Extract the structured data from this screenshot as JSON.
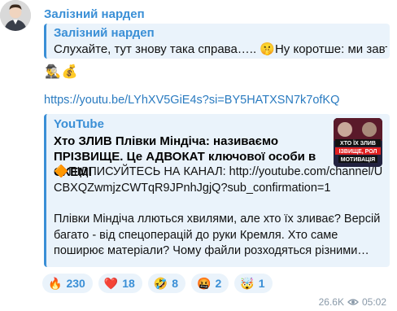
{
  "sender": "Залізний нардеп",
  "reply": {
    "sender": "Залізний нардеп",
    "text": "Слухайте, тут знову така справа….. 🤫Ну коротше: ми завтр…"
  },
  "emoji_line": "🕵️‍♂️💰",
  "link": "https://youtube.com/watch?v=LYhXV5GiE4s&si=BY5HATXSN7k7ofKQ",
  "link_text": "https://youtu.be/LYhXV5GiE4s?si=BY5HATXSN7k7ofKQ",
  "preview": {
    "site": "YouTube",
    "title": "Хто ЗЛИВ Плівки Міндіча: називаємо ПРІЗВИЩЕ. Це АДВОКАТ ключової особи в СХЕМІ",
    "desc_line1": "🔶ПІДПИСУЙТЕСЬ НА КАНАЛ: http://youtube.com/channel/UCBXQZwmjzCWTqR9JPnhJgjQ?sub_confirmation=1",
    "desc_line2": "Плівки Міндіча ллються хвилями, але хто їх зливає? Версій багато - від спецоперацій до руки Кремля. Хто саме поширює матеріали? Чому файли розходяться різними…",
    "thumb_text1": "ХТО ЇХ ЗЛИВ",
    "thumb_text2": "ІЗВИЩЕ, РОЛ",
    "thumb_text3": "МОТИВАЦІЯ"
  },
  "reactions": [
    {
      "emoji": "🔥",
      "count": "230"
    },
    {
      "emoji": "❤️",
      "count": "18"
    },
    {
      "emoji": "🤣",
      "count": "8"
    },
    {
      "emoji": "🤬",
      "count": "2"
    },
    {
      "emoji": "🤯",
      "count": "1"
    }
  ],
  "views": "26.6K",
  "time": "05:02",
  "colors": {
    "accent": "#3a8fd6",
    "link": "#2a7bc0",
    "bubble_quote": "#eaf3fb",
    "meta": "#8a9aa9"
  }
}
